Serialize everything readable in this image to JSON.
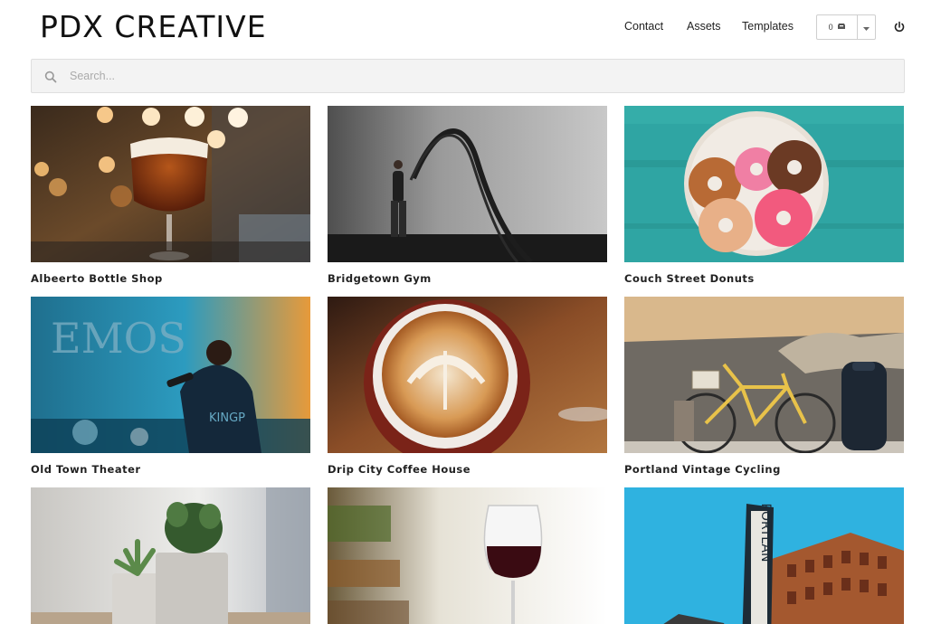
{
  "header": {
    "logo": "PDX CREATIVE",
    "nav": {
      "contact": "Contact",
      "assets": "Assets",
      "templates": "Templates"
    },
    "cart_count": "0",
    "cart_icon": "cart-icon",
    "power_icon": "power-icon"
  },
  "search": {
    "placeholder": "Search...",
    "value": "",
    "icon": "search-icon"
  },
  "grid": {
    "items": [
      {
        "label": "Albeerto Bottle Shop"
      },
      {
        "label": "Bridgetown Gym"
      },
      {
        "label": "Couch Street Donuts"
      },
      {
        "label": "Old Town Theater"
      },
      {
        "label": "Drip City Coffee House"
      },
      {
        "label": "Portland Vintage Cycling"
      },
      {
        "label": ""
      },
      {
        "label": ""
      },
      {
        "label": ""
      }
    ]
  },
  "colors": {
    "text": "#222222",
    "search_bg": "#f3f3f3",
    "border": "#cfcfcf"
  }
}
